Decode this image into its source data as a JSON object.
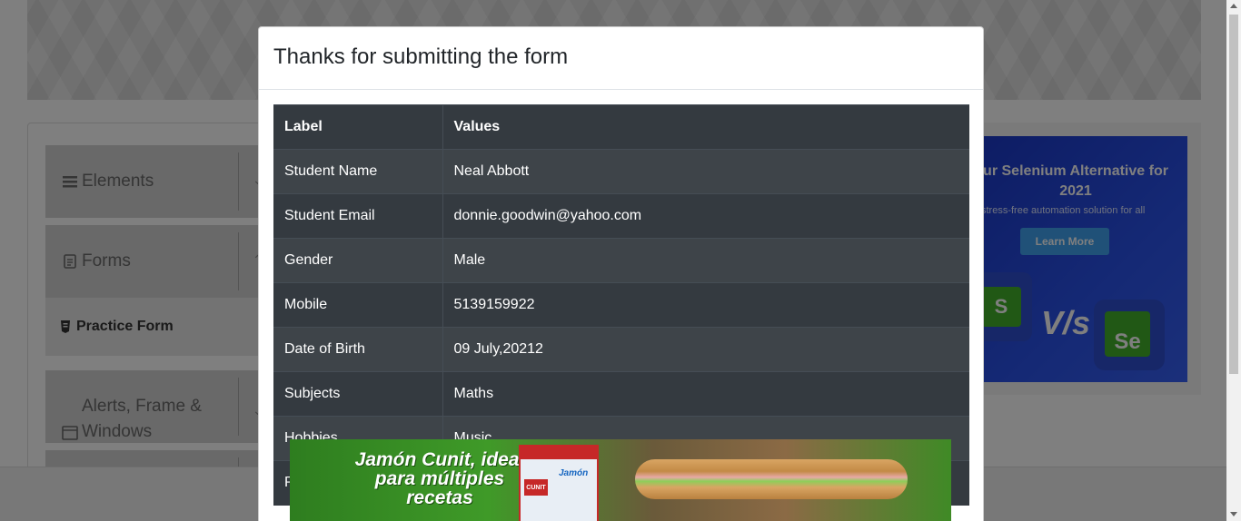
{
  "sidebar": {
    "groups": [
      {
        "label": "Elements",
        "icon": "hamburger-icon"
      },
      {
        "label": "Forms",
        "icon": "document-icon"
      },
      {
        "label": "Alerts, Frame &\nWindows",
        "icon": "window-icon"
      }
    ],
    "active_item": {
      "label": "Practice Form",
      "icon": "html5-icon"
    }
  },
  "ad_right": {
    "headline": "ur Selenium Alternative for 2021",
    "subtitle": "stress-free automation solution for all",
    "button": "Learn More",
    "vs": "V/s"
  },
  "modal": {
    "title": "Thanks for submitting the form",
    "table": {
      "headers": [
        "Label",
        "Values"
      ],
      "rows": [
        [
          "Student Name",
          "Neal Abbott"
        ],
        [
          "Student Email",
          "donnie.goodwin@yahoo.com"
        ],
        [
          "Gender",
          "Male"
        ],
        [
          "Mobile",
          "5139159922"
        ],
        [
          "Date of Birth",
          "09 July,20212"
        ],
        [
          "Subjects",
          "Maths"
        ],
        [
          "Hobbies",
          "Music"
        ],
        [
          "P",
          ""
        ]
      ]
    }
  },
  "ad_bottom": {
    "headline": "Jamón Cunit, ideal para múltiples recetas",
    "pack_label": "Jamón",
    "brand": "CUNIT"
  },
  "colors": {
    "overlay": "rgba(0,0,0,0.5)",
    "table_bg": "#343a40",
    "ad_blue": "#2a52ea",
    "ad_green": "#43b02a"
  }
}
